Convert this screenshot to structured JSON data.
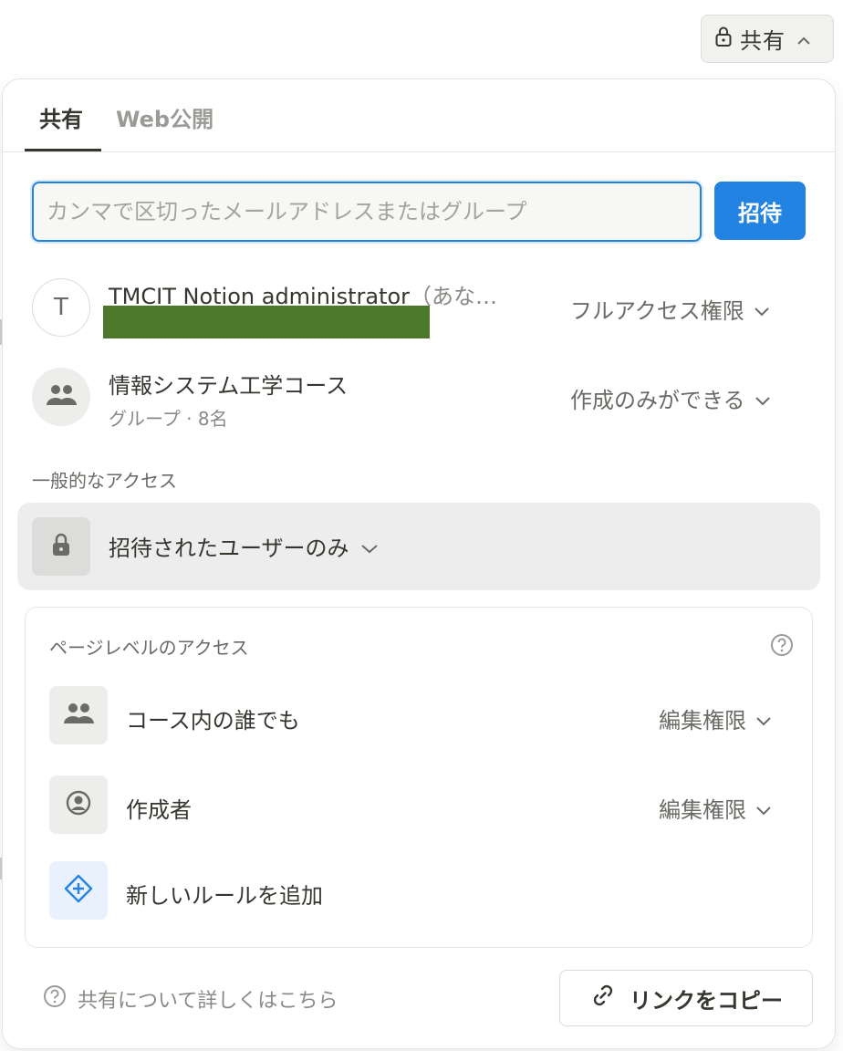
{
  "topbar": {
    "share_label": "共有"
  },
  "tabs": [
    {
      "label": "共有"
    },
    {
      "label": "Web公開"
    }
  ],
  "invite": {
    "placeholder": "カンマで区切ったメールアドレスまたはグループ",
    "value": "",
    "button_label": "招待"
  },
  "members": [
    {
      "initial": "T",
      "name": "TMCIT Notion administrator",
      "suffix": "（あな…",
      "permission": "フルアクセス権限"
    },
    {
      "name": "情報システム工学コース",
      "subtitle": "グループ · 8名",
      "permission": "作成のみができる"
    }
  ],
  "general_access": {
    "section_label": "一般的なアクセス",
    "selected": "招待されたユーザーのみ"
  },
  "page_access": {
    "title": "ページレベルのアクセス",
    "rules": [
      {
        "label": "コース内の誰でも",
        "permission": "編集権限"
      },
      {
        "label": "作成者",
        "permission": "編集権限"
      }
    ],
    "add_label": "新しいルールを追加"
  },
  "footer": {
    "help_label": "共有について詳しくはこちら",
    "copy_label": "リンクをコピー"
  },
  "colors": {
    "accent": "#2383e2",
    "redaction": "#4e7829"
  }
}
